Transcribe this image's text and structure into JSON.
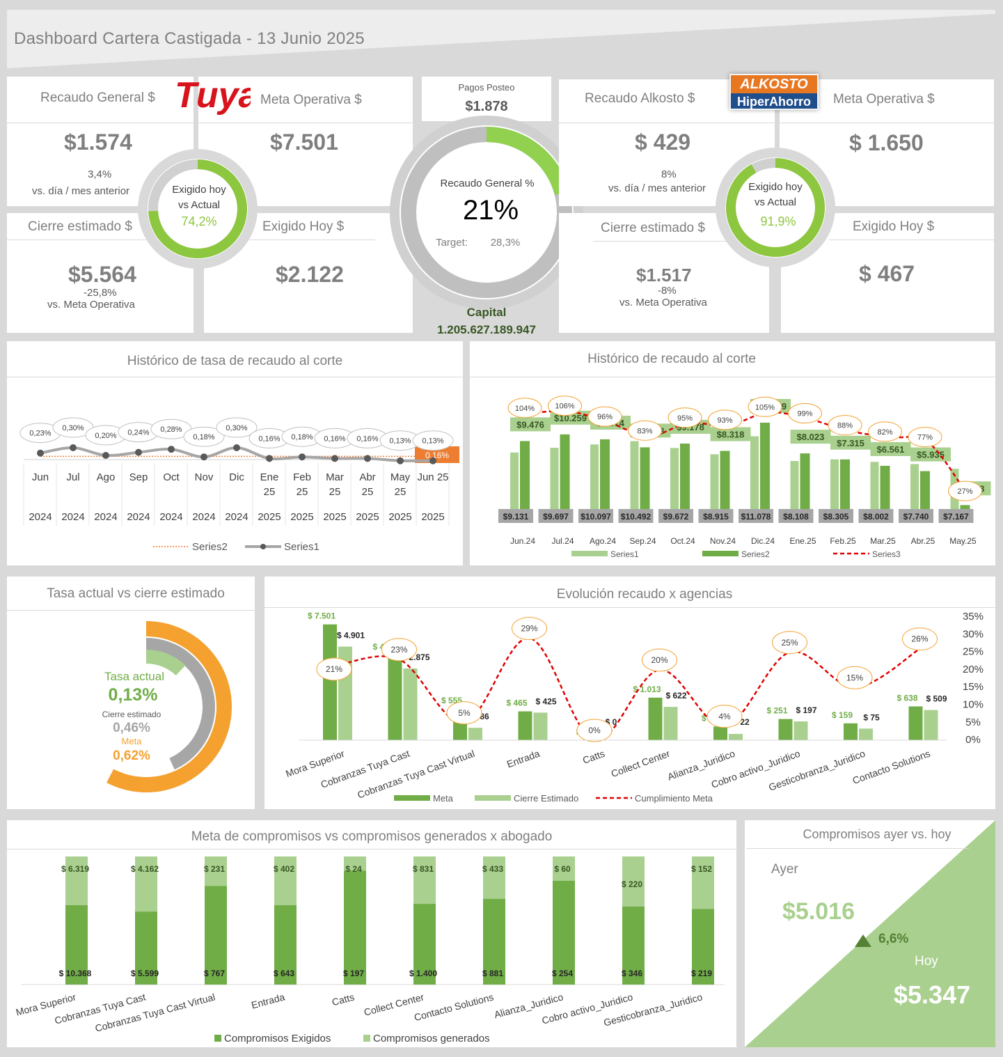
{
  "title": "Dashboard Cartera Castigada - 13 Junio 2025",
  "tuya": {
    "logo_text": "Tuya",
    "recaudo_label": "Recaudo General $",
    "recaudo_value": "$1.574",
    "recaudo_change": "3,4%",
    "recaudo_change_label": "vs. día / mes anterior",
    "meta_label": "Meta Operativa $",
    "meta_value": "$7.501",
    "cierre_label": "Cierre estimado $",
    "cierre_value": "$5.564",
    "cierre_change": "-25,8%",
    "cierre_change_label": "vs. Meta Operativa",
    "exigido_label": "Exigido Hoy $",
    "exigido_value": "$2.122",
    "ring_line1": "Exigido hoy",
    "ring_line2": "vs Actual",
    "ring_value": "74,2%",
    "ring_fraction": 0.742
  },
  "center": {
    "pagos_label": "Pagos Posteo",
    "pagos_value": "$1.878",
    "ring_label": "Recaudo General %",
    "ring_value": "21%",
    "ring_fraction": 0.21,
    "target_label": "Target:",
    "target_value": "28,3%",
    "capital_label": "Capital",
    "capital_value": "1.205.627.189.947"
  },
  "alkosto": {
    "logo_line1": "ALKOSTO",
    "logo_line2": "HiperAhorro",
    "recaudo_label": "Recaudo Alkosto $",
    "recaudo_value": "$ 429",
    "recaudo_change": "8%",
    "recaudo_change_label": "vs. día / mes anterior",
    "meta_label": "Meta Operativa $",
    "meta_value": "$ 1.650",
    "cierre_label": "Cierre estimado $",
    "cierre_value": "$1.517",
    "cierre_change": "-8%",
    "cierre_change_label": "vs. Meta Operativa",
    "exigido_label": "Exigido Hoy $",
    "exigido_value": "$ 467",
    "ring_line1": "Exigido hoy",
    "ring_line2": "vs Actual",
    "ring_value": "91,9%",
    "ring_fraction": 0.919
  },
  "chart_titles": {
    "tasa": "Histórico de tasa de recaudo al corte",
    "recaudo": "Histórico de recaudo al corte",
    "tasa_cierre": "Tasa actual vs cierre estimado",
    "agencias": "Evolución recaudo x agencias",
    "abogados": "Meta de compromisos vs compromisos generados x abogado",
    "compromisos": "Compromisos ayer vs. hoy"
  },
  "chart_data": [
    {
      "type": "line",
      "title": "Histórico de tasa de recaudo al corte",
      "months": [
        "Jun",
        "Jul",
        "Ago",
        "Sep",
        "Oct",
        "Nov",
        "Dic",
        "Ene",
        "Feb",
        "Mar",
        "Abr",
        "May",
        "Jun"
      ],
      "month_suffix": [
        "",
        "",
        "",
        "",
        "",
        "",
        "",
        "25",
        "25",
        "25",
        "25",
        "25",
        "25"
      ],
      "years": [
        "2024",
        "2024",
        "2024",
        "2024",
        "2024",
        "2024",
        "2024",
        "2025",
        "2025",
        "2025",
        "2025",
        "2025",
        "2025"
      ],
      "series": [
        {
          "name": "Series1",
          "values": [
            0.23,
            0.3,
            0.2,
            0.24,
            0.28,
            0.18,
            0.3,
            0.16,
            0.18,
            0.16,
            0.16,
            0.13,
            0.13
          ],
          "labels": [
            "0,23%",
            "0,30%",
            "0,20%",
            "0,24%",
            "0,28%",
            "0,18%",
            "0,30%",
            "0,16%",
            "0,18%",
            "0,16%",
            "0,16%",
            "0,13%",
            "0,13%"
          ]
        },
        {
          "name": "Series2",
          "values": [
            0.16,
            0.16,
            0.16,
            0.16,
            0.16,
            0.16,
            0.16,
            0.16,
            0.16,
            0.16,
            0.16,
            0.16,
            0.16
          ],
          "end_label": "0,16%"
        }
      ]
    },
    {
      "type": "bar",
      "title": "Histórico de recaudo al corte",
      "categories": [
        "Jun.24",
        "Jul.24",
        "Ago.24",
        "Sep.24",
        "Oct.24",
        "Nov.24",
        "Dic.24",
        "Ene.25",
        "Feb.25",
        "Mar.25",
        "Abr.25",
        "May.25"
      ],
      "series": [
        {
          "name": "Series1",
          "values": [
            9131,
            9697,
            10097,
            10492,
            9672,
            8915,
            11078,
            8108,
            8305,
            8002,
            7740,
            7167
          ],
          "labels": [
            "$9.131",
            "$9.697",
            "$10.097",
            "$10.492",
            "$9.672",
            "$8.915",
            "$11.078",
            "$8.108",
            "$8.305",
            "$8.002",
            "$7.740",
            "$7.167"
          ]
        },
        {
          "name": "Series2",
          "values": [
            9476,
            10259,
            9674,
            8738,
            9178,
            8318,
            11639,
            8023,
            7315,
            6561,
            5935,
            1938
          ],
          "labels": [
            "$9.476",
            "$10.259",
            "$9.674",
            "$8.738",
            "$9.178",
            "$8.318",
            "$11.639",
            "$8.023",
            "$7.315",
            "$6.561",
            "$5.935",
            "$1.938"
          ]
        },
        {
          "name": "Series3",
          "values": [
            104,
            106,
            96,
            83,
            95,
            93,
            105,
            99,
            88,
            82,
            77,
            27
          ],
          "labels": [
            "104%",
            "106%",
            "96%",
            "83%",
            "95%",
            "93%",
            "105%",
            "99%",
            "88%",
            "82%",
            "77%",
            "27%"
          ]
        }
      ]
    },
    {
      "type": "pie",
      "title": "Tasa actual vs cierre estimado",
      "items": [
        {
          "label": "Tasa actual",
          "value": "0,13%",
          "num": 0.13,
          "color": "#a9d08e"
        },
        {
          "label": "Cierre estimado",
          "value": "0,46%",
          "num": 0.46,
          "color": "#a6a6a6"
        },
        {
          "label": "Meta",
          "value": "0,62%",
          "num": 0.62,
          "color": "#f4a12f"
        }
      ]
    },
    {
      "type": "bar",
      "title": "Evolución recaudo x agencias",
      "categories": [
        "Mora Superior",
        "Cobranzas Tuya Cast",
        "Cobranzas Tuya Cast Virtual",
        "Entrada",
        "Catts",
        "Collect Center",
        "Alianza_Juridico",
        "Cobro activo_Juridico",
        "Gesticobranza_Juridico",
        "Contacto Solutions"
      ],
      "right_axis": [
        "35%",
        "30%",
        "25%",
        "20%",
        "15%",
        "10%",
        "5%",
        "0%"
      ],
      "series": [
        {
          "name": "Meta",
          "values": [
            7501,
            4051,
            555,
            465,
            0,
            1013,
            104,
            251,
            159,
            638
          ],
          "labels": [
            "$ 7.501",
            "$ 4.051",
            "$ 555",
            "$ 465",
            "$ 0",
            "$ 1.013",
            "$ 104",
            "$ 251",
            "$ 159",
            "$ 638"
          ]
        },
        {
          "name": "Cierre Estimado",
          "values": [
            4901,
            2875,
            86,
            425,
            0,
            622,
            22,
            197,
            75,
            509
          ],
          "labels": [
            "$ 4.901",
            "$ 2.875",
            "$ 86",
            "$ 425",
            "$ 0",
            "$ 622",
            "$ 22",
            "$ 197",
            "$ 75",
            "$ 509"
          ]
        },
        {
          "name": "Cumplimiento Meta",
          "values": [
            21,
            23,
            5,
            29,
            0,
            20,
            4,
            25,
            15,
            26
          ],
          "labels": [
            "21%",
            "23%",
            "5%",
            "29%",
            "0%",
            "20%",
            "4%",
            "25%",
            "15%",
            "26%"
          ]
        }
      ]
    },
    {
      "type": "bar",
      "title": "Meta de compromisos vs compromisos generados x abogado",
      "categories": [
        "Mora Superior",
        "Cobranzas Tuya Cast",
        "Cobranzas Tuya Cast Virtual",
        "Entrada",
        "Catts",
        "Collect Center",
        "Contacto Solutions",
        "Alianza_Juridico",
        "Cobro activo_Juridico",
        "Gesticobranza_Juridico"
      ],
      "series": [
        {
          "name": "Compromisos Exigidos",
          "labels": [
            "$ 10.368",
            "$ 5.599",
            "$ 767",
            "$ 643",
            "$ 197",
            "$ 1.400",
            "$ 881",
            "$ 254",
            "$ 346",
            "$ 219"
          ],
          "share": [
            0.62,
            0.57,
            0.77,
            0.62,
            0.89,
            0.63,
            0.67,
            0.81,
            0.61,
            0.59
          ]
        },
        {
          "name": "Compromisos generados",
          "labels": [
            "$ 6.319",
            "$ 4.162",
            "$ 231",
            "$ 402",
            "$ 24",
            "$ 831",
            "$ 433",
            "$ 60",
            "$ 220",
            "$ 152"
          ]
        }
      ]
    }
  ],
  "compromisos": {
    "ayer_label": "Ayer",
    "ayer_value": "$5.016",
    "change": "6,6%",
    "hoy_label": "Hoy",
    "hoy_value": "$5.347"
  },
  "colors": {
    "green_dark": "#70ad47",
    "green_light": "#a9d08e",
    "green_bright": "#92d050",
    "orange": "#f4a12f",
    "red_line": "#e00000",
    "grey": "#a6a6a6"
  }
}
